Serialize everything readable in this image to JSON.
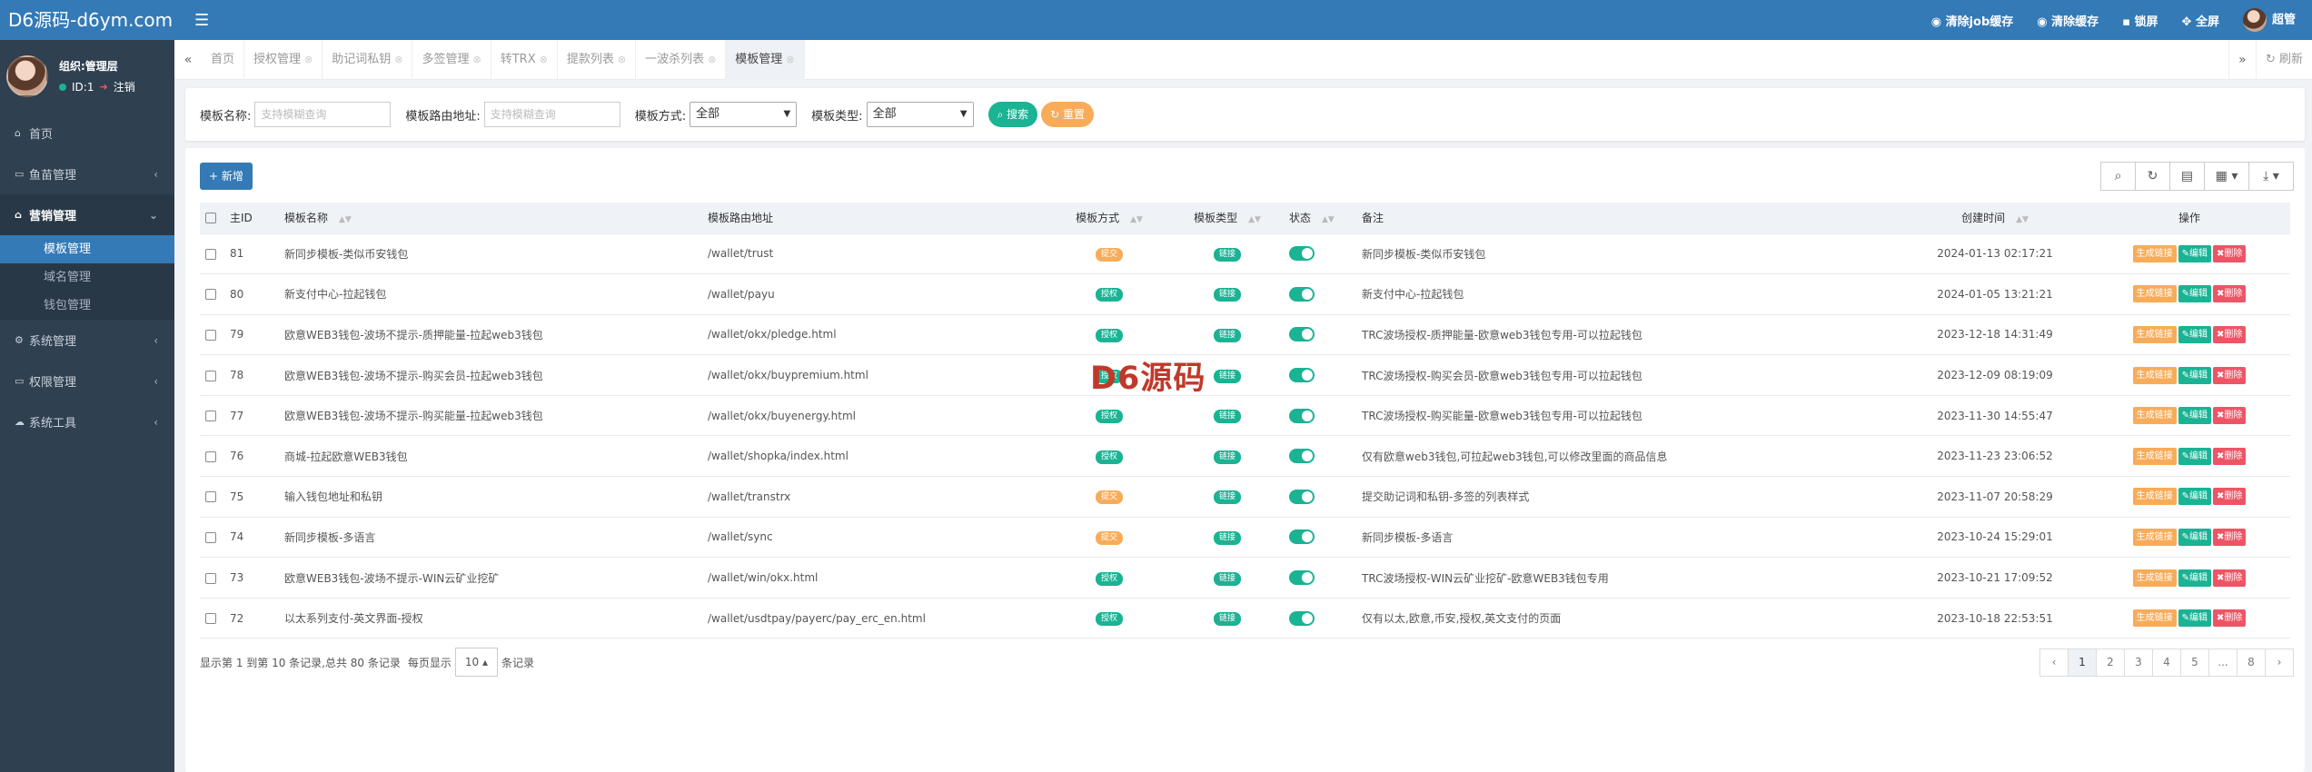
{
  "app": {
    "logo": "D6源码-d6ym.com"
  },
  "profile": {
    "name": "组织:管理层",
    "id_text": "ID:1",
    "logout": "注销"
  },
  "sidebar": {
    "items": [
      {
        "label": "首页",
        "icon": "home-icon",
        "glyph": "⌂"
      },
      {
        "label": "鱼苗管理",
        "icon": "id-card-icon",
        "glyph": "▭",
        "caret": "‹"
      },
      {
        "label": "营销管理",
        "icon": "bank-icon",
        "glyph": "⌂",
        "caret": "⌄",
        "active": true
      },
      {
        "label": "系统管理",
        "icon": "gear-icon",
        "glyph": "⚙",
        "caret": "‹"
      },
      {
        "label": "权限管理",
        "icon": "id-badge-icon",
        "glyph": "▭",
        "caret": "‹"
      },
      {
        "label": "系统工具",
        "icon": "cloud-icon",
        "glyph": "☁",
        "caret": "‹"
      }
    ],
    "sub_items": [
      {
        "label": "模板管理",
        "active": true
      },
      {
        "label": "域名管理"
      },
      {
        "label": "钱包管理"
      }
    ]
  },
  "topbar": {
    "actions": [
      "清除job缓存",
      "清除缓存",
      "锁屏",
      "全屏"
    ],
    "user": "超管"
  },
  "tabs": [
    {
      "label": "首页"
    },
    {
      "label": "授权管理"
    },
    {
      "label": "助记词私钥"
    },
    {
      "label": "多签管理"
    },
    {
      "label": "转TRX"
    },
    {
      "label": "提款列表"
    },
    {
      "label": "一波杀列表"
    },
    {
      "label": "模板管理",
      "active": true
    }
  ],
  "tab_refresh": "刷新",
  "search": {
    "name_label": "模板名称:",
    "name_placeholder": "支持模糊查询",
    "route_label": "模板路由地址:",
    "route_placeholder": "支持模糊查询",
    "method_label": "模板方式:",
    "method_value": "全部",
    "type_label": "模板类型:",
    "type_value": "全部",
    "search_btn": "搜索",
    "reset_btn": "重置"
  },
  "add_btn": "新增",
  "table": {
    "headers": [
      "主ID",
      "模板名称",
      "模板路由地址",
      "模板方式",
      "模板类型",
      "状态",
      "备注",
      "创建时间",
      "操作"
    ],
    "rows": [
      {
        "id": "81",
        "name": "新同步模板-类似币安钱包",
        "route": "/wallet/trust",
        "method": "提交",
        "method_color": "#f8ac59",
        "type": "链接",
        "remark": "新同步模板-类似币安钱包",
        "time": "2024-01-13 02:17:21"
      },
      {
        "id": "80",
        "name": "新支付中心-拉起钱包",
        "route": "/wallet/payu",
        "method": "授权",
        "method_color": "#1ab394",
        "type": "链接",
        "remark": "新支付中心-拉起钱包",
        "time": "2024-01-05 13:21:21"
      },
      {
        "id": "79",
        "name": "欧意WEB3钱包-波场不提示-质押能量-拉起web3钱包",
        "route": "/wallet/okx/pledge.html",
        "method": "授权",
        "method_color": "#1ab394",
        "type": "链接",
        "remark": "TRC波场授权-质押能量-欧意web3钱包专用-可以拉起钱包",
        "time": "2023-12-18 14:31:49"
      },
      {
        "id": "78",
        "name": "欧意WEB3钱包-波场不提示-购买会员-拉起web3钱包",
        "route": "/wallet/okx/buypremium.html",
        "method": "授权",
        "method_color": "#1ab394",
        "type": "链接",
        "remark": "TRC波场授权-购买会员-欧意web3钱包专用-可以拉起钱包",
        "time": "2023-12-09 08:19:09"
      },
      {
        "id": "77",
        "name": "欧意WEB3钱包-波场不提示-购买能量-拉起web3钱包",
        "route": "/wallet/okx/buyenergy.html",
        "method": "授权",
        "method_color": "#1ab394",
        "type": "链接",
        "remark": "TRC波场授权-购买能量-欧意web3钱包专用-可以拉起钱包",
        "time": "2023-11-30 14:55:47"
      },
      {
        "id": "76",
        "name": "商城-拉起欧意WEB3钱包",
        "route": "/wallet/shopka/index.html",
        "method": "授权",
        "method_color": "#1ab394",
        "type": "链接",
        "remark": "仅有欧意web3钱包,可拉起web3钱包,可以修改里面的商品信息",
        "time": "2023-11-23 23:06:52"
      },
      {
        "id": "75",
        "name": "输入钱包地址和私钥",
        "route": "/wallet/transtrx",
        "method": "提交",
        "method_color": "#f8ac59",
        "type": "链接",
        "remark": "提交助记词和私钥-多签的列表样式",
        "time": "2023-11-07 20:58:29"
      },
      {
        "id": "74",
        "name": "新同步模板-多语言",
        "route": "/wallet/sync",
        "method": "提交",
        "method_color": "#f8ac59",
        "type": "链接",
        "remark": "新同步模板-多语言",
        "time": "2023-10-24 15:29:01"
      },
      {
        "id": "73",
        "name": "欧意WEB3钱包-波场不提示-WIN云矿业挖矿",
        "route": "/wallet/win/okx.html",
        "method": "授权",
        "method_color": "#1ab394",
        "type": "链接",
        "remark": "TRC波场授权-WIN云矿业挖矿-欧意WEB3钱包专用",
        "time": "2023-10-21 17:09:52"
      },
      {
        "id": "72",
        "name": "以太系列支付-英文界面-授权",
        "route": "/wallet/usdtpay/payerc/pay_erc_en.html",
        "method": "授权",
        "method_color": "#1ab394",
        "type": "链接",
        "remark": "仅有以太,欧意,币安,授权,英文支付的页面",
        "time": "2023-10-18 22:53:51"
      }
    ],
    "ops": {
      "link": "生成链接",
      "edit": "编辑",
      "del": "删除"
    }
  },
  "pager": {
    "info": "显示第 1 到第 10 条记录,总共 80 条记录",
    "per_page_prefix": "每页显示",
    "per_page": "10",
    "per_page_suffix": "条记录",
    "pages": [
      "‹",
      "1",
      "2",
      "3",
      "4",
      "5",
      "...",
      "8",
      "›"
    ]
  },
  "watermark": "D6源码",
  "colors": {
    "primary": "#337ab7",
    "sidebar": "#2f4050",
    "green": "#1ab394",
    "orange": "#f8ac59",
    "red": "#ed5565"
  }
}
